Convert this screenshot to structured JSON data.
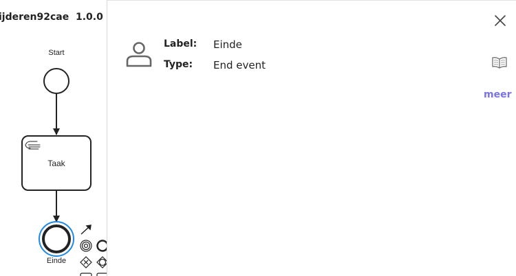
{
  "process": {
    "title": "ijderen92cae",
    "version": "1.0.0"
  },
  "diagram": {
    "start_event_label": "Start",
    "task_label": "Taak",
    "task_icon": "manual-task-hand-icon",
    "end_event_label": "Einde",
    "selected_element": "Einde",
    "selection_color": "#1e88e5"
  },
  "details": {
    "element_icon": "user-icon",
    "label_key": "Label:",
    "label_value": "Einde",
    "type_key": "Type:",
    "type_value": "End event",
    "more_link": "meer",
    "more_link_color": "#7b73e2",
    "close_icon": "close-icon",
    "docs_icon": "open-book-icon"
  }
}
